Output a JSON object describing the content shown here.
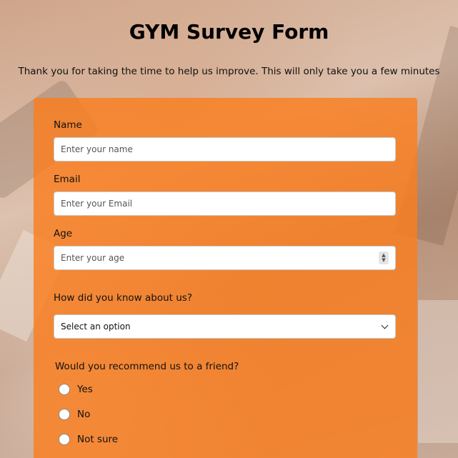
{
  "header": {
    "title": "GYM Survey Form",
    "description": "Thank you for taking the time to help us improve. This will only take you a few minutes"
  },
  "form": {
    "name": {
      "label": "Name",
      "placeholder": "Enter your name"
    },
    "email": {
      "label": "Email",
      "placeholder": "Enter your Email"
    },
    "age": {
      "label": "Age",
      "placeholder": "Enter your age"
    },
    "source": {
      "label": "How did you know about us?",
      "selected": "Select an option"
    },
    "recommend": {
      "question": "Would you recommend us to a friend?",
      "options": [
        "Yes",
        "No",
        "Not sure"
      ]
    }
  },
  "colors": {
    "card": "#fa7e1e",
    "input_background": "#ffffff"
  },
  "icons": {
    "select_arrow": "chevron-down-icon",
    "age_stepper": "spin-arrows-icon"
  }
}
